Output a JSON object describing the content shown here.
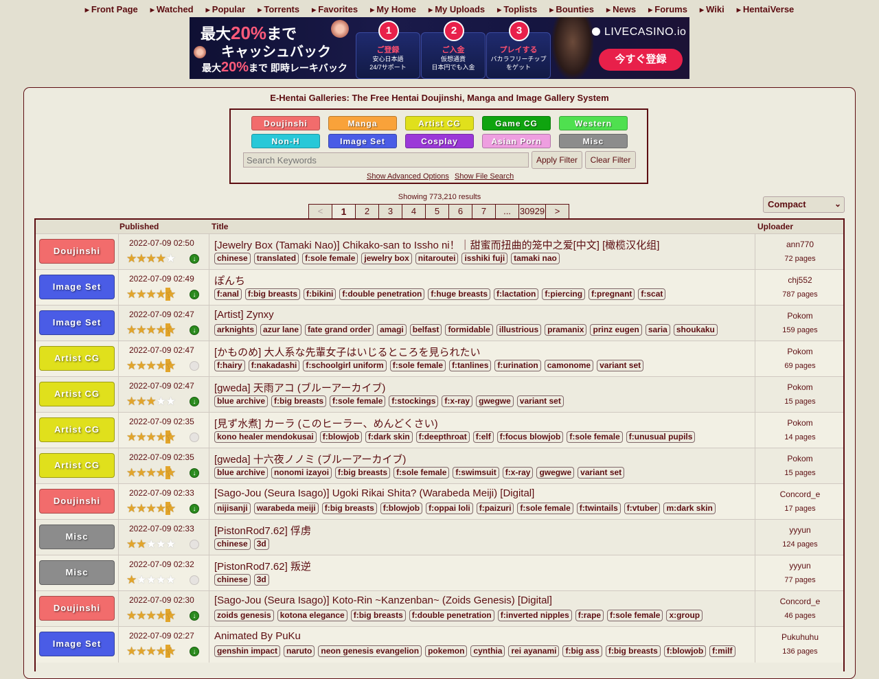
{
  "nav": {
    "items": [
      "Front Page",
      "Watched",
      "Popular",
      "Torrents",
      "Favorites",
      "My Home",
      "My Uploads",
      "Toplists",
      "Bounties",
      "News",
      "Forums",
      "Wiki",
      "HentaiVerse"
    ]
  },
  "banner": {
    "line1_pct": "20%",
    "line1_rest": "まで",
    "line1_prefix": "最大",
    "line2": "キャッシュバック",
    "line3_prefix": "最大",
    "line3_pct": "20%",
    "line3_rest": "まで 即時レーキバック",
    "steps": [
      {
        "num": "1",
        "title": "ご登録",
        "desc": "安心日本語\n24/7サポート"
      },
      {
        "num": "2",
        "title": "ご入金",
        "desc": "仮想通貨\n日本円でも入金"
      },
      {
        "num": "3",
        "title": "プレイする",
        "desc": "バカラフリーチップ\nをゲット"
      }
    ],
    "logo": "LIVECASINO.io",
    "cta": "今すぐ登録"
  },
  "site_title": "E-Hentai Galleries: The Free Hentai Doujinshi, Manga and Image Gallery System",
  "categories": [
    {
      "label": "Doujinshi",
      "color": "#f26c6c"
    },
    {
      "label": "Manga",
      "color": "#f9a23a"
    },
    {
      "label": "Artist CG",
      "color": "#e0e01c"
    },
    {
      "label": "Game CG",
      "color": "#0fa40f"
    },
    {
      "label": "Western",
      "color": "#4fe04f"
    },
    {
      "label": "Non-H",
      "color": "#28c8d8"
    },
    {
      "label": "Image Set",
      "color": "#4a5ce6"
    },
    {
      "label": "Cosplay",
      "color": "#9b38d8"
    },
    {
      "label": "Asian Porn",
      "color": "#ee9ee0"
    },
    {
      "label": "Misc",
      "color": "#8c8c8c"
    }
  ],
  "search": {
    "placeholder": "Search Keywords",
    "apply": "Apply Filter",
    "clear": "Clear Filter",
    "advanced": "Show Advanced Options",
    "file_search": "Show File Search"
  },
  "results_count": "Showing 773,210 results",
  "pager": [
    "<",
    "1",
    "2",
    "3",
    "4",
    "5",
    "6",
    "7",
    "...",
    "30929",
    ">"
  ],
  "pager_current": "1",
  "display_mode": "Compact",
  "columns": {
    "published": "Published",
    "title": "Title",
    "uploader": "Uploader"
  },
  "rows": [
    {
      "cat": "Doujinshi",
      "color": "#f26c6c",
      "date": "2022-07-09 02:50",
      "rating": 4,
      "torrent": true,
      "title": "[Jewelry Box (Tamaki Nao)] Chikako-san to Issho ni！｜甜蜜而扭曲的笼中之爱[中文] [橄榄汉化组]",
      "tags": [
        "chinese",
        "translated",
        "f:sole female",
        "jewelry box",
        "nitaroutei",
        "isshiki fuji",
        "tamaki nao"
      ],
      "uploader": "ann770",
      "pages": "72 pages"
    },
    {
      "cat": "Image Set",
      "color": "#4a5ce6",
      "date": "2022-07-09 02:49",
      "rating": 4.5,
      "torrent": true,
      "title": "ぽんち",
      "tags": [
        "f:anal",
        "f:big breasts",
        "f:bikini",
        "f:double penetration",
        "f:huge breasts",
        "f:lactation",
        "f:piercing",
        "f:pregnant",
        "f:scat"
      ],
      "uploader": "chj552",
      "pages": "787 pages"
    },
    {
      "cat": "Image Set",
      "color": "#4a5ce6",
      "date": "2022-07-09 02:47",
      "rating": 4.5,
      "torrent": true,
      "title": "[Artist] Zynxy",
      "tags": [
        "arknights",
        "azur lane",
        "fate grand order",
        "amagi",
        "belfast",
        "formidable",
        "illustrious",
        "pramanix",
        "prinz eugen",
        "saria",
        "shoukaku"
      ],
      "uploader": "Pokom",
      "pages": "159 pages"
    },
    {
      "cat": "Artist CG",
      "color": "#e0e01c",
      "date": "2022-07-09 02:47",
      "rating": 4.5,
      "torrent": false,
      "title": "[かものめ] 大人系な先輩女子はいじるところを見られたい",
      "tags": [
        "f:hairy",
        "f:nakadashi",
        "f:schoolgirl uniform",
        "f:sole female",
        "f:tanlines",
        "f:urination",
        "camonome",
        "variant set"
      ],
      "uploader": "Pokom",
      "pages": "69 pages"
    },
    {
      "cat": "Artist CG",
      "color": "#e0e01c",
      "date": "2022-07-09 02:47",
      "rating": 3,
      "torrent": true,
      "title": "[gweda] 天雨アコ (ブルーアーカイブ)",
      "tags": [
        "blue archive",
        "f:big breasts",
        "f:sole female",
        "f:stockings",
        "f:x-ray",
        "gwegwe",
        "variant set"
      ],
      "uploader": "Pokom",
      "pages": "15 pages"
    },
    {
      "cat": "Artist CG",
      "color": "#e0e01c",
      "date": "2022-07-09 02:35",
      "rating": 4.5,
      "torrent": false,
      "title": "[見ず水煮] カーラ (このヒーラー、めんどくさい)",
      "tags": [
        "kono healer mendokusai",
        "f:blowjob",
        "f:dark skin",
        "f:deepthroat",
        "f:elf",
        "f:focus blowjob",
        "f:sole female",
        "f:unusual pupils"
      ],
      "uploader": "Pokom",
      "pages": "14 pages"
    },
    {
      "cat": "Artist CG",
      "color": "#e0e01c",
      "date": "2022-07-09 02:35",
      "rating": 4.5,
      "torrent": true,
      "title": "[gweda] 十六夜ノノミ (ブルーアーカイブ)",
      "tags": [
        "blue archive",
        "nonomi izayoi",
        "f:big breasts",
        "f:sole female",
        "f:swimsuit",
        "f:x-ray",
        "gwegwe",
        "variant set"
      ],
      "uploader": "Pokom",
      "pages": "15 pages"
    },
    {
      "cat": "Doujinshi",
      "color": "#f26c6c",
      "date": "2022-07-09 02:33",
      "rating": 4.5,
      "torrent": true,
      "title": "[Sago-Jou (Seura Isago)] Ugoki Rikai Shita? (Warabeda Meiji) [Digital]",
      "tags": [
        "nijisanji",
        "warabeda meiji",
        "f:big breasts",
        "f:blowjob",
        "f:oppai loli",
        "f:paizuri",
        "f:sole female",
        "f:twintails",
        "f:vtuber",
        "m:dark skin"
      ],
      "uploader": "Concord_e",
      "pages": "17 pages"
    },
    {
      "cat": "Misc",
      "color": "#8c8c8c",
      "date": "2022-07-09 02:33",
      "rating": 2,
      "torrent": false,
      "title": "[PistonRod7.62] 俘虏",
      "tags": [
        "chinese",
        "3d"
      ],
      "uploader": "yyyun",
      "pages": "124 pages"
    },
    {
      "cat": "Misc",
      "color": "#8c8c8c",
      "date": "2022-07-09 02:32",
      "rating": 1,
      "torrent": false,
      "title": "[PistonRod7.62] 叛逆",
      "tags": [
        "chinese",
        "3d"
      ],
      "uploader": "yyyun",
      "pages": "77 pages"
    },
    {
      "cat": "Doujinshi",
      "color": "#f26c6c",
      "date": "2022-07-09 02:30",
      "rating": 4.5,
      "torrent": true,
      "title": "[Sago-Jou (Seura Isago)] Koto-Rin ~Kanzenban~ (Zoids Genesis) [Digital]",
      "tags": [
        "zoids genesis",
        "kotona elegance",
        "f:big breasts",
        "f:double penetration",
        "f:inverted nipples",
        "f:rape",
        "f:sole female",
        "x:group"
      ],
      "uploader": "Concord_e",
      "pages": "46 pages"
    },
    {
      "cat": "Image Set",
      "color": "#4a5ce6",
      "date": "2022-07-09 02:27",
      "rating": 4.5,
      "torrent": true,
      "title": "Animated By PuKu",
      "tags": [
        "genshin impact",
        "naruto",
        "neon genesis evangelion",
        "pokemon",
        "cynthia",
        "rei ayanami",
        "f:big ass",
        "f:big breasts",
        "f:blowjob",
        "f:milf"
      ],
      "uploader": "Pukuhuhu",
      "pages": "136 pages"
    }
  ]
}
